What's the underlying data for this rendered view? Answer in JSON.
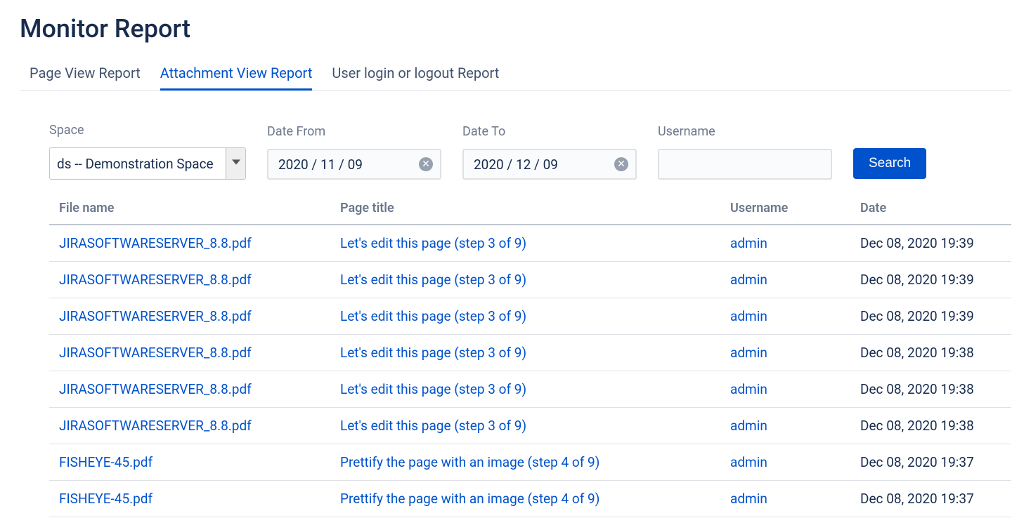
{
  "page_title": "Monitor Report",
  "tabs": [
    {
      "label": "Page View Report",
      "active": false
    },
    {
      "label": "Attachment View Report",
      "active": true
    },
    {
      "label": "User login or logout Report",
      "active": false
    }
  ],
  "filters": {
    "space": {
      "label": "Space",
      "value": "ds -- Demonstration Space"
    },
    "date_from": {
      "label": "Date From",
      "value": "2020 / 11 / 09"
    },
    "date_to": {
      "label": "Date To",
      "value": "2020 / 12 / 09"
    },
    "username": {
      "label": "Username",
      "value": ""
    },
    "search_label": "Search"
  },
  "columns": {
    "file_name": "File name",
    "page_title": "Page title",
    "username": "Username",
    "date": "Date"
  },
  "rows": [
    {
      "file": "JIRASOFTWARESERVER_8.8.pdf",
      "page": "Let's edit this page (step 3 of 9)",
      "user": "admin",
      "date": "Dec 08, 2020 19:39"
    },
    {
      "file": "JIRASOFTWARESERVER_8.8.pdf",
      "page": "Let's edit this page (step 3 of 9)",
      "user": "admin",
      "date": "Dec 08, 2020 19:39"
    },
    {
      "file": "JIRASOFTWARESERVER_8.8.pdf",
      "page": "Let's edit this page (step 3 of 9)",
      "user": "admin",
      "date": "Dec 08, 2020 19:39"
    },
    {
      "file": "JIRASOFTWARESERVER_8.8.pdf",
      "page": "Let's edit this page (step 3 of 9)",
      "user": "admin",
      "date": "Dec 08, 2020 19:38"
    },
    {
      "file": "JIRASOFTWARESERVER_8.8.pdf",
      "page": "Let's edit this page (step 3 of 9)",
      "user": "admin",
      "date": "Dec 08, 2020 19:38"
    },
    {
      "file": "JIRASOFTWARESERVER_8.8.pdf",
      "page": "Let's edit this page (step 3 of 9)",
      "user": "admin",
      "date": "Dec 08, 2020 19:38"
    },
    {
      "file": "FISHEYE-45.pdf",
      "page": "Prettify the page with an image (step 4 of 9)",
      "user": "admin",
      "date": "Dec 08, 2020 19:37"
    },
    {
      "file": "FISHEYE-45.pdf",
      "page": "Prettify the page with an image (step 4 of 9)",
      "user": "admin",
      "date": "Dec 08, 2020 19:37"
    }
  ]
}
